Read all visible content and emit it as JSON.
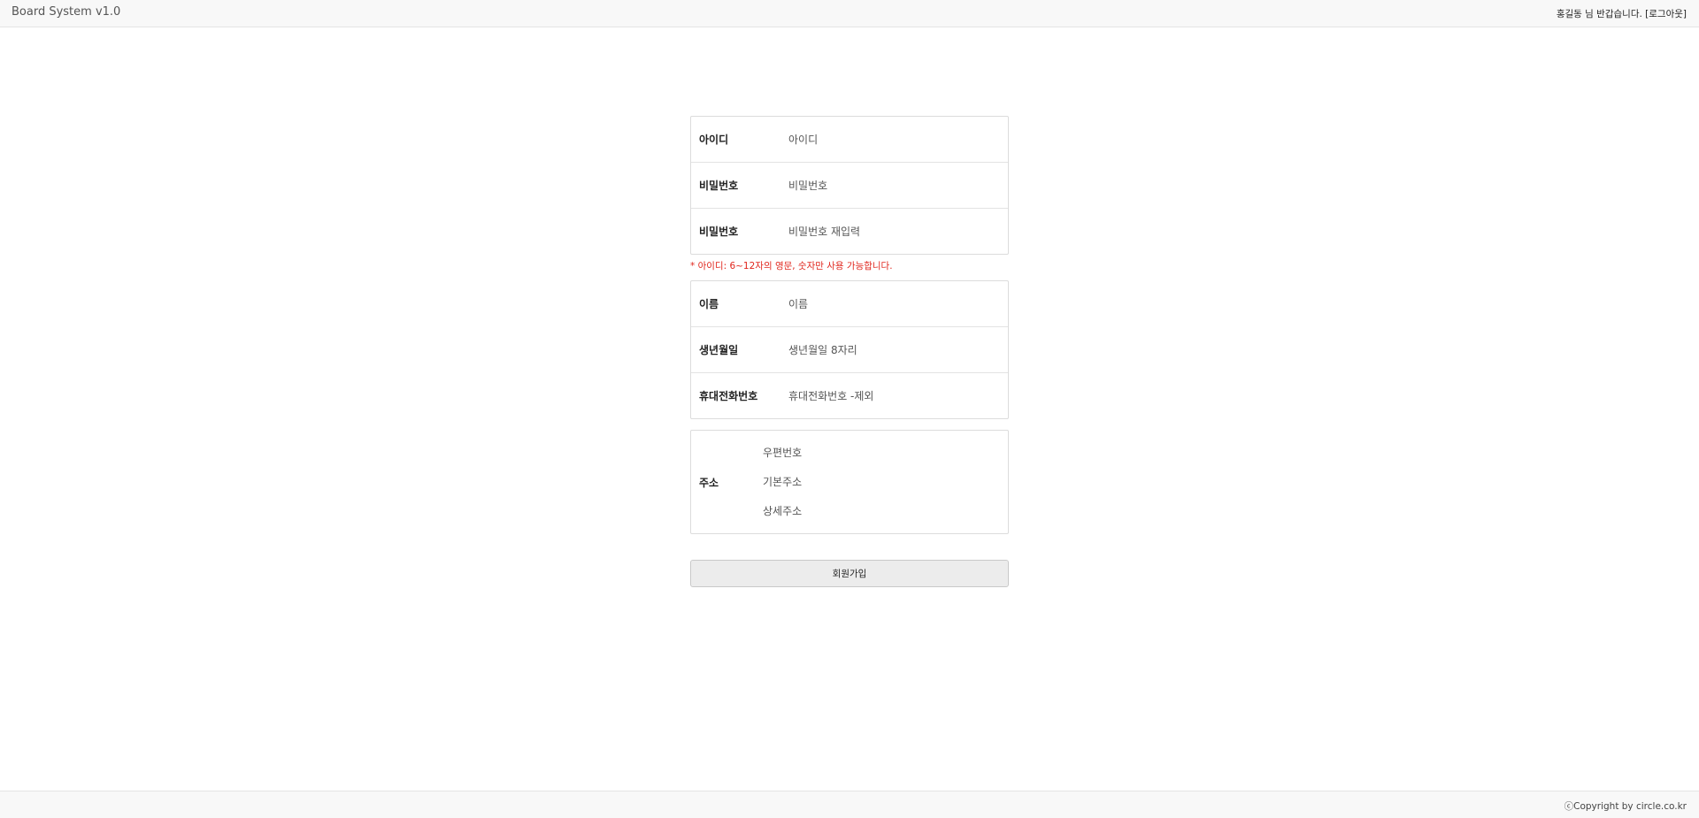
{
  "header": {
    "brand": "Board System v1.0",
    "welcome_text": "홍길동 님 반갑습니다.",
    "logout_label": "[로그아웃]"
  },
  "account": {
    "id_label": "아이디",
    "id_placeholder": "아이디",
    "password_label": "비밀번호",
    "password_placeholder": "비밀번호",
    "password_confirm_label": "비밀번호",
    "password_confirm_placeholder": "비밀번호 재입력"
  },
  "notice": "* 아이디: 6~12자의 영문, 숫자만 사용 가능합니다.",
  "profile": {
    "name_label": "이름",
    "name_placeholder": "이름",
    "birth_label": "생년월일",
    "birth_placeholder": "생년월일 8자리",
    "phone_label": "휴대전화번호",
    "phone_placeholder": "휴대전화번호 -제외"
  },
  "address": {
    "label": "주소",
    "zipcode_placeholder": "우편번호",
    "basic_placeholder": "기본주소",
    "detail_placeholder": "상세주소"
  },
  "submit_label": "회원가입",
  "footer": {
    "copyright": "ⓒCopyright by circle.co.kr"
  }
}
